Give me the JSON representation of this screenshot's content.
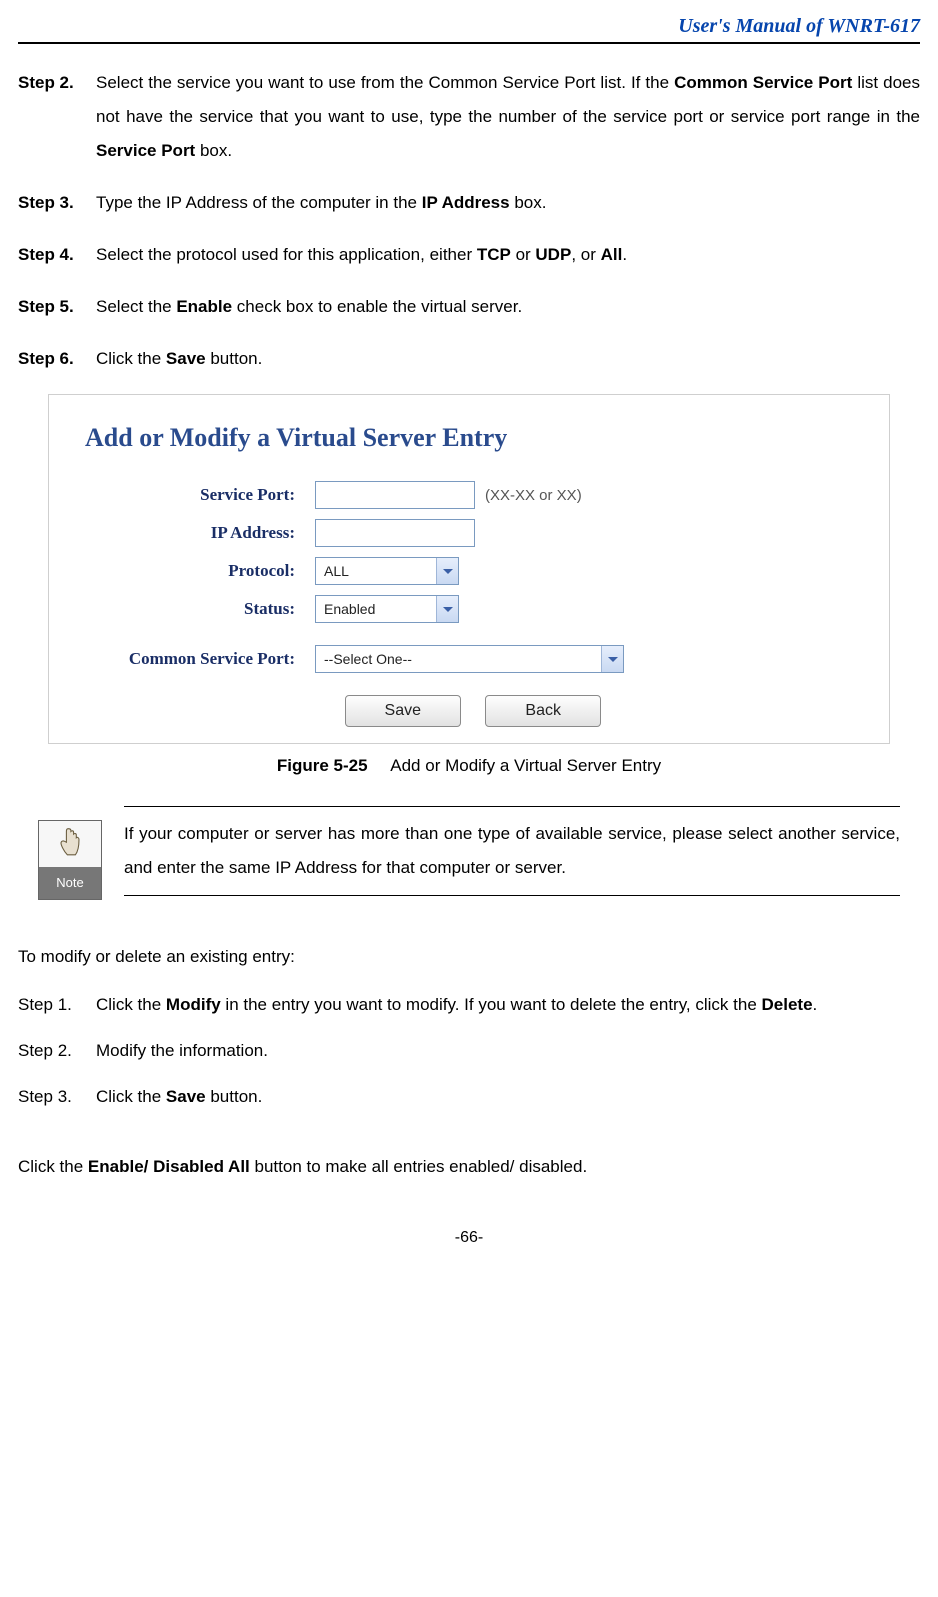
{
  "header": {
    "title": "User's Manual of WNRT-617"
  },
  "steps": [
    {
      "label": "Step 2.",
      "parts": [
        {
          "t": "plain",
          "v": "Select the service you want to use from the Common Service Port list. If the "
        },
        {
          "t": "bold",
          "v": "Common Service Port"
        },
        {
          "t": "plain",
          "v": " list does not have the service that you want to use, type the number of the service port or service port range in the "
        },
        {
          "t": "bold",
          "v": "Service Port"
        },
        {
          "t": "plain",
          "v": " box."
        }
      ]
    },
    {
      "label": "Step 3.",
      "parts": [
        {
          "t": "plain",
          "v": "Type the IP Address of the computer in the "
        },
        {
          "t": "bold",
          "v": "IP Address"
        },
        {
          "t": "plain",
          "v": " box."
        }
      ]
    },
    {
      "label": "Step 4.",
      "parts": [
        {
          "t": "plain",
          "v": "Select the protocol used for this application, either "
        },
        {
          "t": "bold",
          "v": "TCP"
        },
        {
          "t": "plain",
          "v": " or "
        },
        {
          "t": "bold",
          "v": "UDP"
        },
        {
          "t": "plain",
          "v": ", or "
        },
        {
          "t": "bold",
          "v": "All"
        },
        {
          "t": "plain",
          "v": "."
        }
      ]
    },
    {
      "label": "Step 5.",
      "parts": [
        {
          "t": "plain",
          "v": "Select the "
        },
        {
          "t": "bold",
          "v": "Enable"
        },
        {
          "t": "plain",
          "v": " check box to enable the virtual server."
        }
      ]
    },
    {
      "label": "Step 6.",
      "parts": [
        {
          "t": "plain",
          "v": "Click the "
        },
        {
          "t": "bold",
          "v": "Save"
        },
        {
          "t": "plain",
          "v": " button."
        }
      ]
    }
  ],
  "figure": {
    "title": "Add or Modify a Virtual Server Entry",
    "fields": {
      "service_port": {
        "label": "Service Port:",
        "value": "",
        "hint": "(XX-XX or XX)"
      },
      "ip_address": {
        "label": "IP Address:",
        "value": ""
      },
      "protocol": {
        "label": "Protocol:",
        "value": "ALL"
      },
      "status": {
        "label": "Status:",
        "value": "Enabled"
      },
      "common": {
        "label": "Common Service Port:",
        "value": "--Select One--"
      }
    },
    "buttons": {
      "save": "Save",
      "back": "Back"
    }
  },
  "caption": {
    "label": "Figure 5-25",
    "text": "Add or Modify a Virtual Server Entry"
  },
  "note": {
    "badge": "Note",
    "text": "If your computer or server has more than one type of available service, please select another service, and enter the same IP Address for that computer or server."
  },
  "modify": {
    "intro": "To modify or delete an existing entry:",
    "steps": [
      {
        "label": "Step 1.",
        "parts": [
          {
            "t": "plain",
            "v": "Click the "
          },
          {
            "t": "bold",
            "v": "Modify"
          },
          {
            "t": "plain",
            "v": " in the entry you want to modify. If you want to delete the entry, click the "
          },
          {
            "t": "bold",
            "v": "Delete"
          },
          {
            "t": "plain",
            "v": "."
          }
        ]
      },
      {
        "label": "Step 2.",
        "parts": [
          {
            "t": "plain",
            "v": "Modify the information."
          }
        ]
      },
      {
        "label": "Step 3.",
        "parts": [
          {
            "t": "plain",
            "v": "Click the "
          },
          {
            "t": "bold",
            "v": "Save"
          },
          {
            "t": "plain",
            "v": " button."
          }
        ]
      }
    ],
    "trailing": {
      "parts": [
        {
          "t": "plain",
          "v": "Click the "
        },
        {
          "t": "bold",
          "v": "Enable/ Disabled All"
        },
        {
          "t": "plain",
          "v": " button to make all entries enabled/ disabled."
        }
      ]
    }
  },
  "footer": {
    "page": "-66-"
  }
}
